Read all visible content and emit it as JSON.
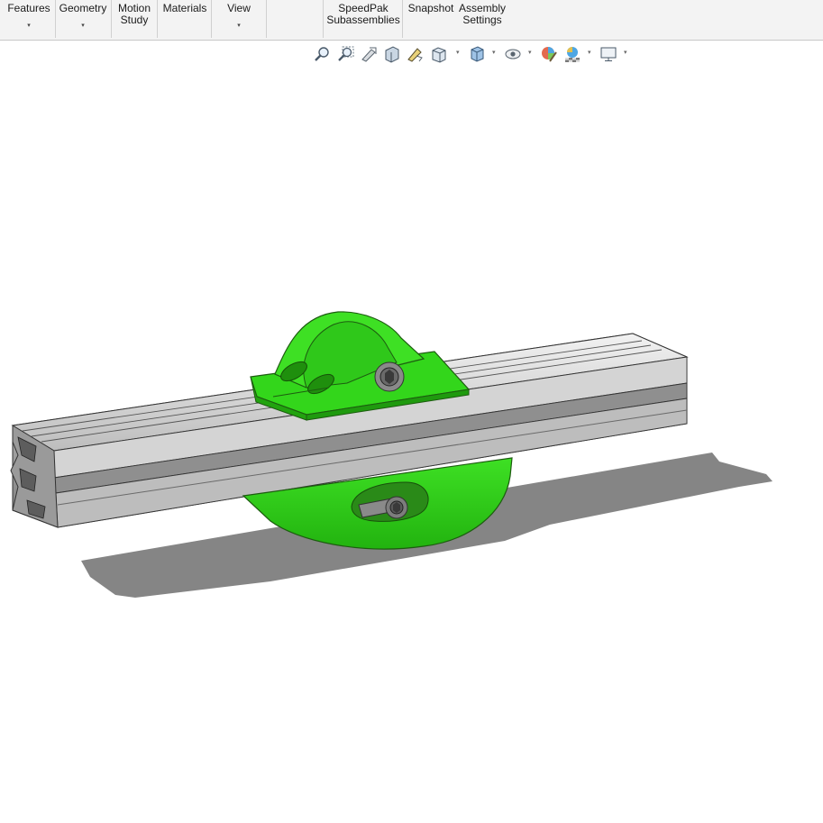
{
  "ribbon": {
    "buttons": [
      {
        "id": "features",
        "line1": "Features",
        "line2": "",
        "dropdown": true
      },
      {
        "id": "geometry",
        "line1": "Geometry",
        "line2": "",
        "dropdown": true
      },
      {
        "id": "motion",
        "line1": "Motion",
        "line2": "Study",
        "dropdown": false
      },
      {
        "id": "materials",
        "line1": "Materials",
        "line2": "",
        "dropdown": false
      },
      {
        "id": "view",
        "line1": "View",
        "line2": "",
        "dropdown": true
      },
      {
        "id": "speedpak",
        "line1": "SpeedPak",
        "line2": "Subassemblies",
        "dropdown": false
      },
      {
        "id": "snapshot",
        "line1": "Snapshot",
        "line2": "",
        "dropdown": false
      },
      {
        "id": "assembly-settings",
        "line1": "Assembly",
        "line2": "Settings",
        "dropdown": false
      }
    ],
    "dropdown_glyph": "▾"
  },
  "heads_up_toolbar": {
    "icons": [
      "zoom-to-fit-icon",
      "zoom-to-area-icon",
      "previous-view-icon",
      "section-view-icon",
      "dynamic-annotation-icon",
      "view-orientation-icon",
      "display-style-icon",
      "hide-show-items-icon",
      "edit-appearance-icon",
      "apply-scene-icon",
      "view-settings-icon"
    ]
  },
  "model": {
    "bracket_color": "#33e01a",
    "extrusion_color": "#b5b5b5",
    "shadow_color": "#8a8a8a"
  }
}
